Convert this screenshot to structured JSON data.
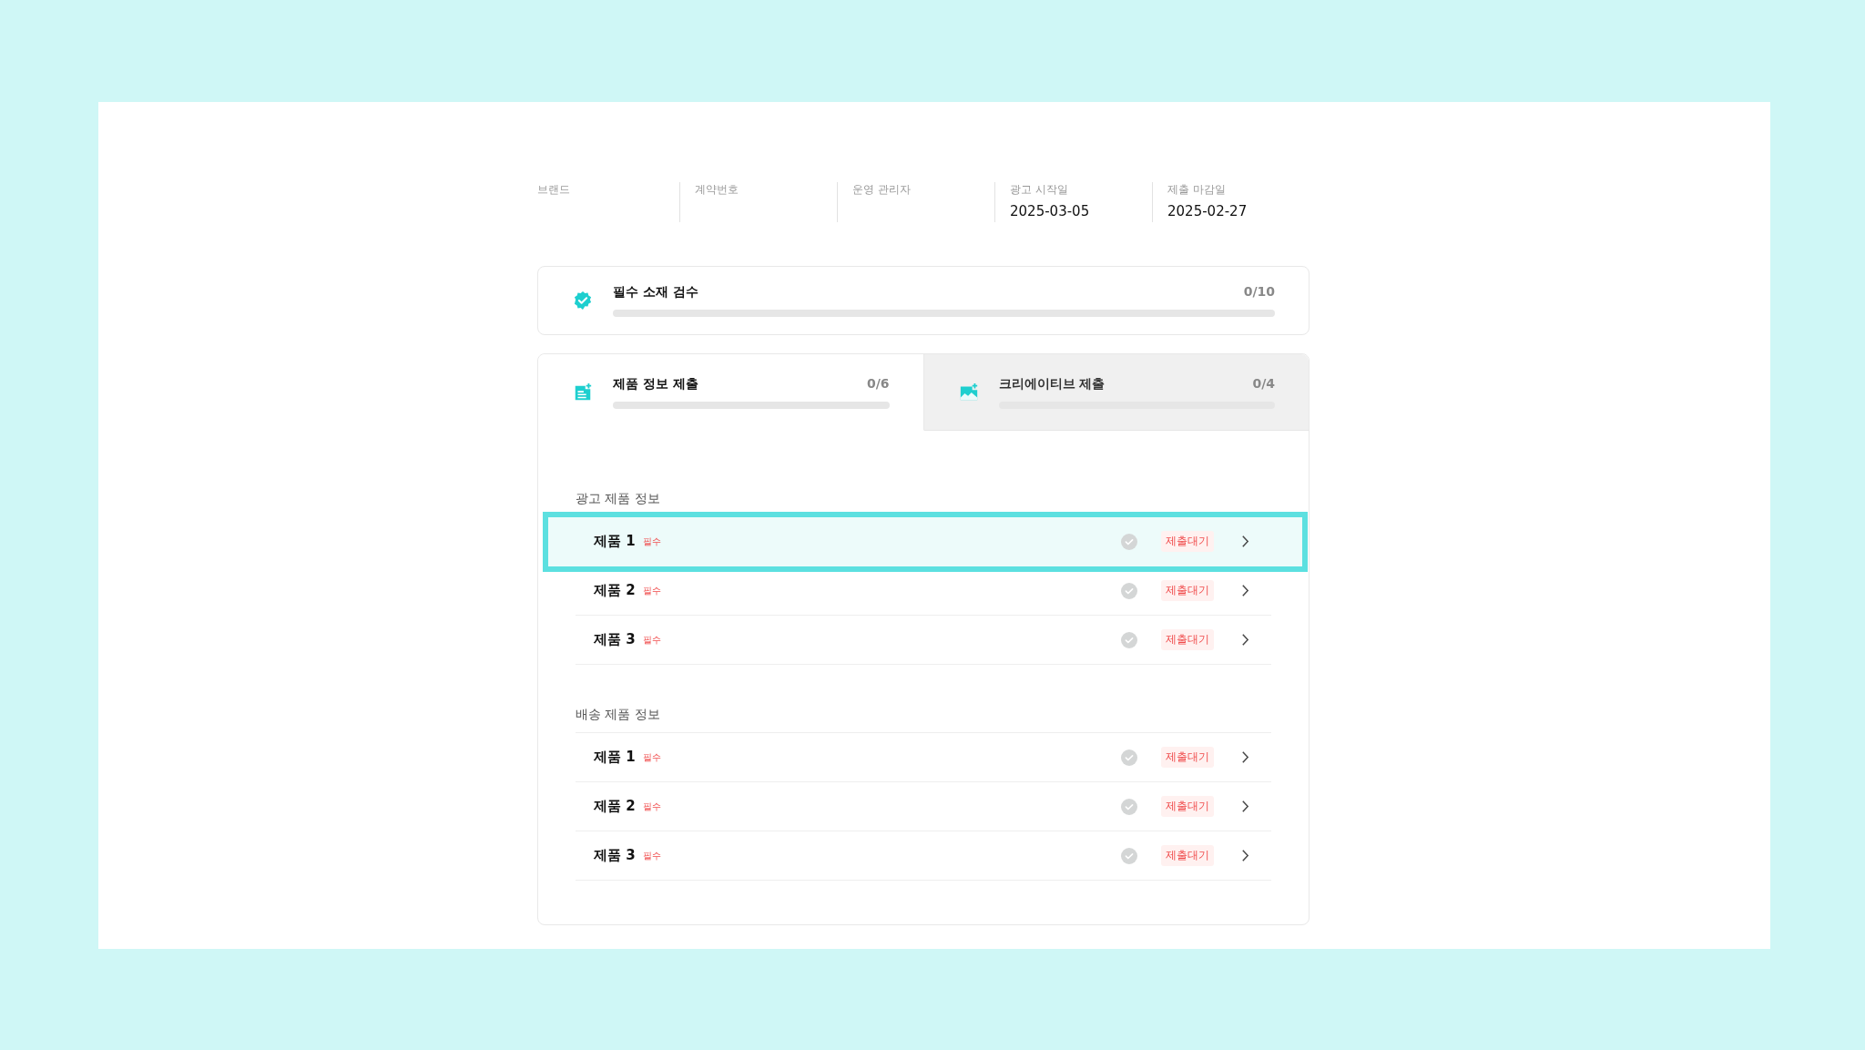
{
  "info": [
    {
      "label": "브랜드"
    },
    {
      "label": "계약번호"
    },
    {
      "label": "운영 관리자"
    },
    {
      "label": "광고 시작일",
      "value": "2025-03-05"
    },
    {
      "label": "제출 마감일",
      "value": "2025-02-27"
    }
  ],
  "review": {
    "title": "필수 소재 검수",
    "count": "0/10",
    "level": 0
  },
  "tabs": [
    {
      "kind": "document",
      "title": "제품 정보 제출",
      "count": "0/6",
      "level": 0,
      "selected": true
    },
    {
      "kind": "image",
      "title": "크리에이티브 제출",
      "count": "0/4",
      "level": 0,
      "selected": false
    }
  ],
  "sections": [
    {
      "title": "광고 제품 정보",
      "rows": [
        {
          "name": "제품 1",
          "badge": "필수",
          "status": "제출대기",
          "done": false,
          "selected": true
        },
        {
          "name": "제품 2",
          "badge": "필수",
          "status": "제출대기",
          "done": false,
          "selected": false
        },
        {
          "name": "제품 3",
          "badge": "필수",
          "status": "제출대기",
          "done": false,
          "selected": false
        }
      ]
    },
    {
      "title": "배송 제품 정보",
      "rows": [
        {
          "name": "제품 1",
          "badge": "필수",
          "status": "제출대기",
          "done": false,
          "selected": false
        },
        {
          "name": "제품 2",
          "badge": "필수",
          "status": "제출대기",
          "done": false,
          "selected": false
        },
        {
          "name": "제품 3",
          "badge": "필수",
          "status": "제출대기",
          "done": false,
          "selected": false
        }
      ]
    }
  ]
}
